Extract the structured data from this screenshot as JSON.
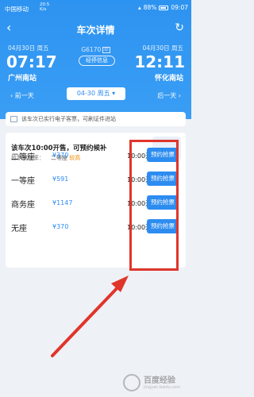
{
  "status_bar": {
    "carrier": "中国移动",
    "speed_value": "20.5",
    "speed_unit": "K/s",
    "battery": "88%",
    "time": "09:07"
  },
  "nav": {
    "title": "车次详情"
  },
  "trip": {
    "departure_date": "04月30日 周五",
    "departure_time": "07:17",
    "departure_station": "广州南站",
    "train_number": "G6170",
    "id_badge": "ID",
    "stop_info_label": "经停信息",
    "arrival_date": "04月30日 周五",
    "arrival_time": "12:11",
    "arrival_station": "怀化南站"
  },
  "date_bar": {
    "prev": "前一天",
    "current": "04-30 周五",
    "next": "后一天"
  },
  "notice": "该车次已实行电子客票，可刷证件进站",
  "waitlist": {
    "title": "该车次10:00开售，可预约候补",
    "rate_label": "抢票成功率：",
    "rate_tier": "二等座",
    "rate_level": "较高"
  },
  "seats": [
    {
      "name": "二等座",
      "price": "¥370",
      "time": "10:00开售",
      "button": "预约抢票"
    },
    {
      "name": "一等座",
      "price": "¥591",
      "time": "10:00开售",
      "button": "预约抢票"
    },
    {
      "name": "商务座",
      "price": "¥1147",
      "time": "10:00开售",
      "button": "预约抢票"
    },
    {
      "name": "无座",
      "price": "¥370",
      "time": "10:00开售",
      "button": "预约抢票"
    }
  ],
  "watermark": {
    "main": "百度经验",
    "sub": "jingyan.baidu.com"
  },
  "colors": {
    "primary": "#2d8cf0",
    "highlight": "#e0352b",
    "rate_level": "#f08c00"
  }
}
